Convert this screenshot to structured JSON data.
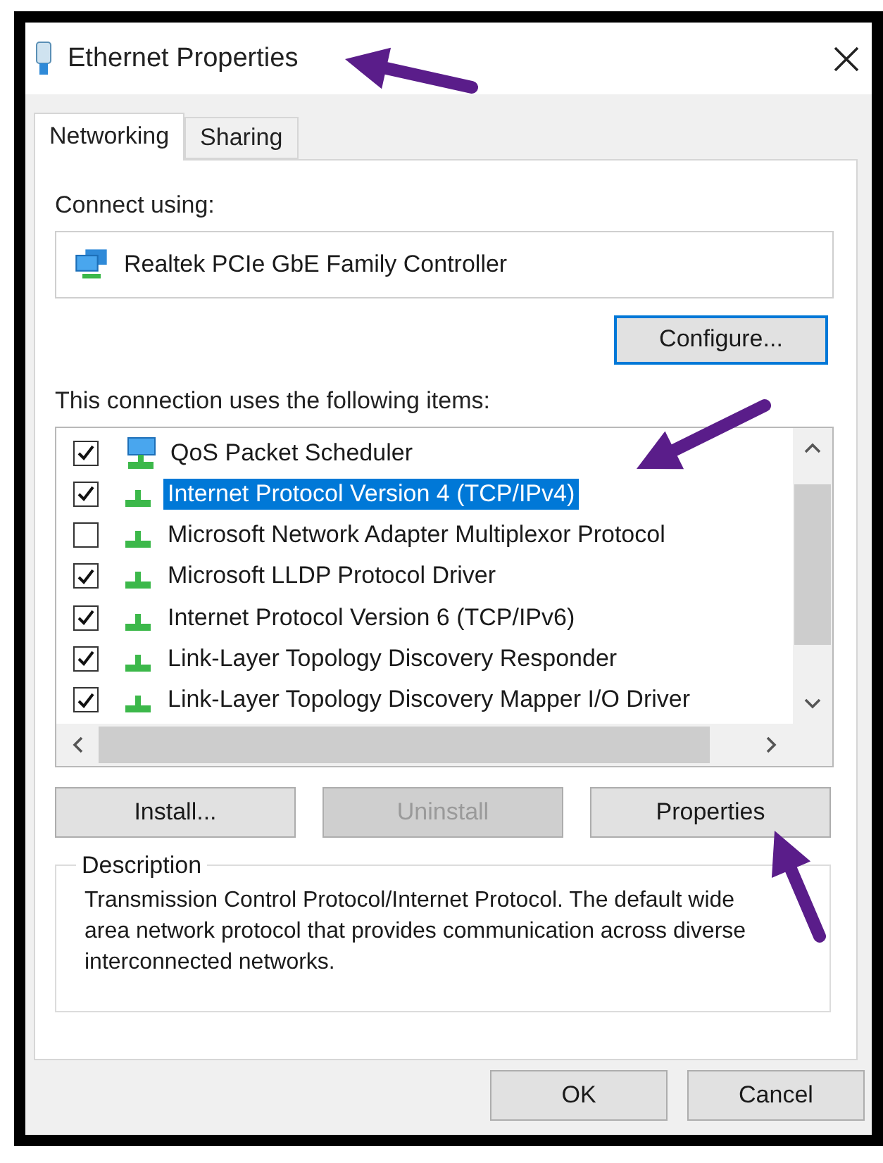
{
  "window": {
    "title": "Ethernet Properties"
  },
  "tabs": [
    {
      "label": "Networking",
      "selected": true
    },
    {
      "label": "Sharing",
      "selected": false
    }
  ],
  "connect_using": {
    "label": "Connect using:",
    "adapter": "Realtek PCIe GbE Family Controller"
  },
  "configure_button": "Configure...",
  "items_label": "This connection uses the following items:",
  "items": [
    {
      "label": "QoS Packet Scheduler",
      "checked": true,
      "selected": false,
      "kind": "service"
    },
    {
      "label": "Internet Protocol Version 4 (TCP/IPv4)",
      "checked": true,
      "selected": true,
      "kind": "protocol"
    },
    {
      "label": "Microsoft Network Adapter Multiplexor Protocol",
      "checked": false,
      "selected": false,
      "kind": "protocol"
    },
    {
      "label": "Microsoft LLDP Protocol Driver",
      "checked": true,
      "selected": false,
      "kind": "protocol"
    },
    {
      "label": "Internet Protocol Version 6 (TCP/IPv6)",
      "checked": true,
      "selected": false,
      "kind": "protocol"
    },
    {
      "label": "Link-Layer Topology Discovery Responder",
      "checked": true,
      "selected": false,
      "kind": "protocol"
    },
    {
      "label": "Link-Layer Topology Discovery Mapper I/O Driver",
      "checked": true,
      "selected": false,
      "kind": "protocol"
    }
  ],
  "item_buttons": [
    {
      "label": "Install...",
      "disabled": false
    },
    {
      "label": "Uninstall",
      "disabled": true
    },
    {
      "label": "Properties",
      "disabled": false
    }
  ],
  "description": {
    "legend": "Description",
    "text": "Transmission Control Protocol/Internet Protocol. The default wide area network protocol that provides communication across diverse interconnected networks."
  },
  "footer_buttons": [
    {
      "label": "OK"
    },
    {
      "label": "Cancel"
    }
  ]
}
